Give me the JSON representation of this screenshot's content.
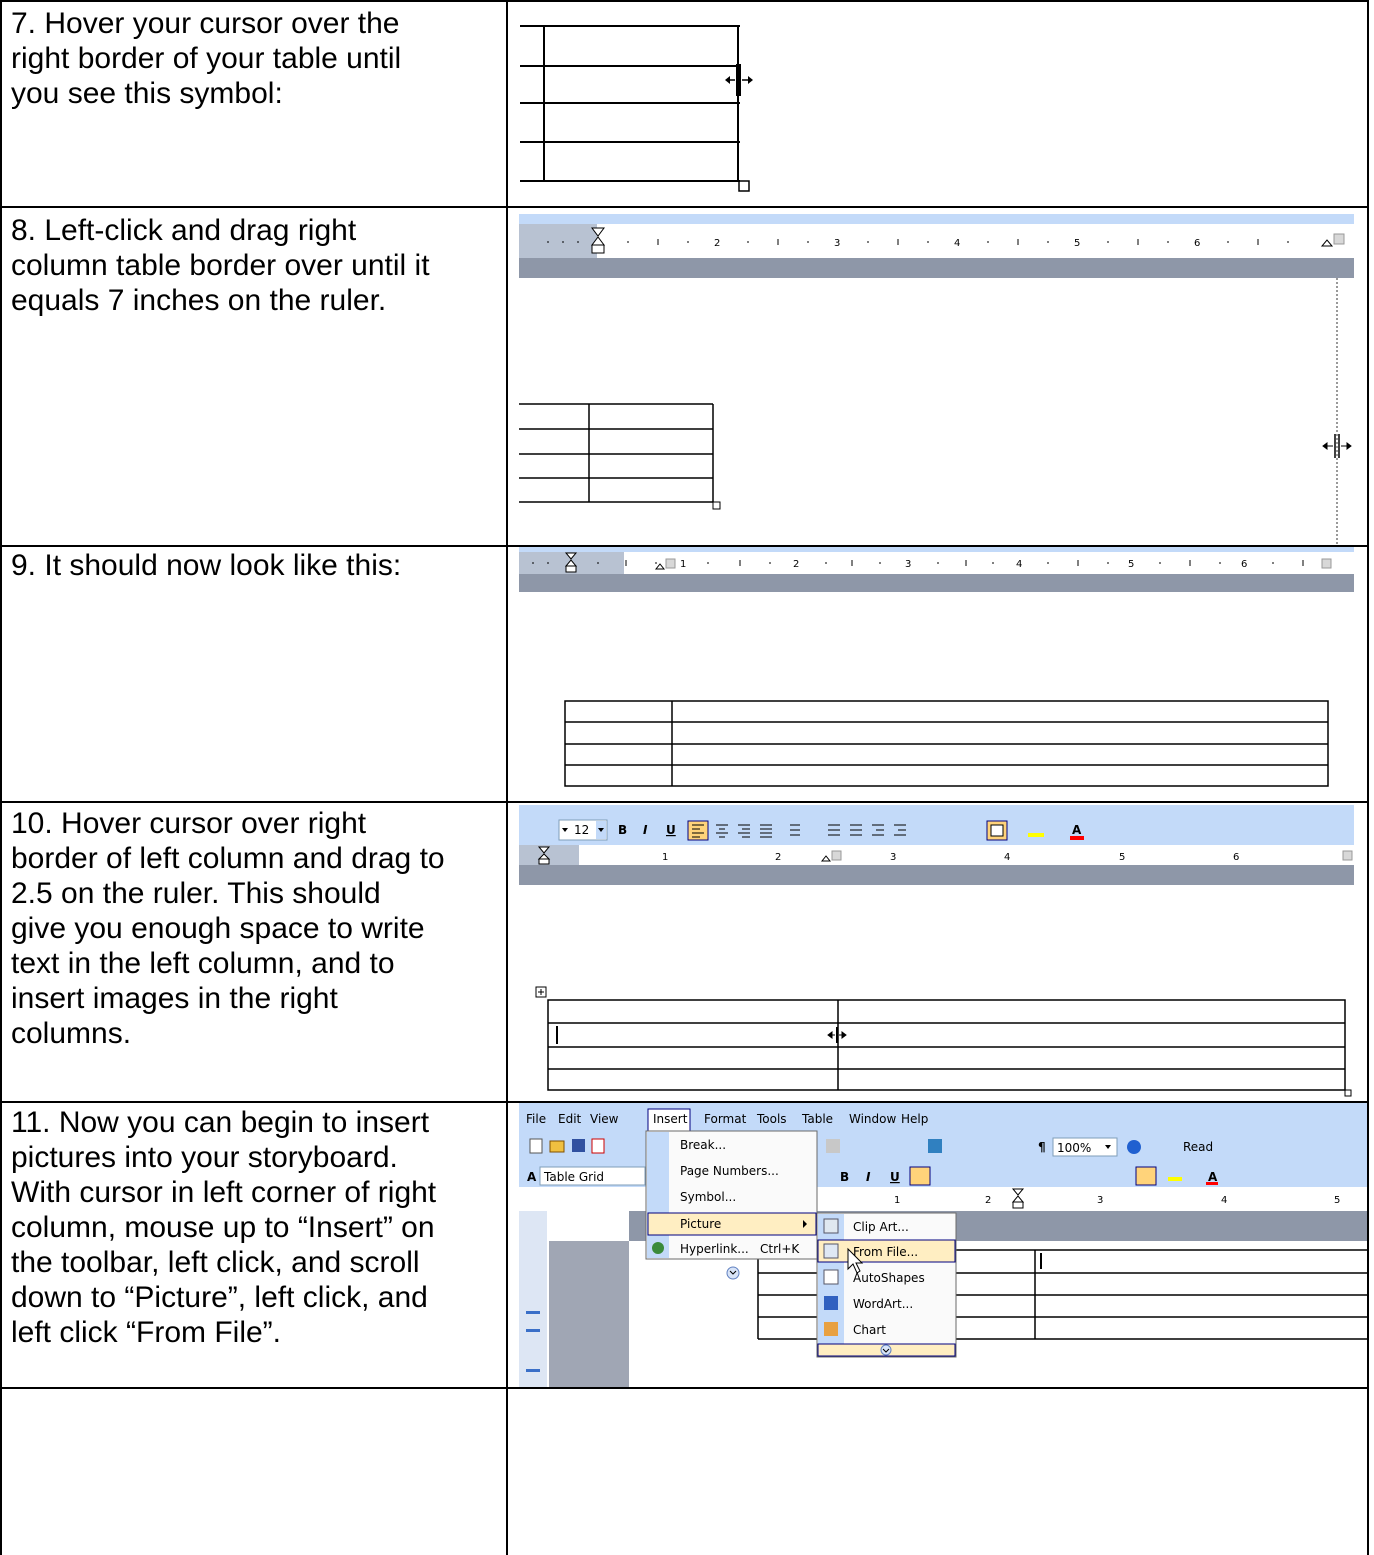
{
  "rows": [
    {
      "step": "7. Hover your cursor over the\nright border of your table until\nyou see this symbol:"
    },
    {
      "step": "8. Left-click and drag right\ncolumn table border over until it\nequals 7 inches on the ruler."
    },
    {
      "step": "9. It should now look like this:"
    },
    {
      "step": "10. Hover cursor over right\nborder of left column and drag to\n2.5 on the ruler.  This should\ngive you enough space to write\ntext in the left column, and to\ninsert images in the right\ncolumns."
    },
    {
      "step": "11. Now you can begin to insert\npictures into your storyboard.\nWith cursor in left corner of right\ncolumn, mouse up to “Insert” on\nthe toolbar, left click, and scroll\ndown to “Picture”, left click, and\nleft click “From File”."
    },
    {
      "step": ""
    }
  ],
  "ruler_numbers": [
    "1",
    "2",
    "3",
    "4",
    "5",
    "6"
  ],
  "toolbar": {
    "font_size": "12",
    "bold": "B",
    "italic": "I",
    "underline": "U",
    "zoom": "100%",
    "read": "Read",
    "style": "Table Grid",
    "style_icon": "A",
    "pilcrow": "¶"
  },
  "menubar": [
    "File",
    "Edit",
    "View",
    "Insert",
    "Format",
    "Tools",
    "Table",
    "Window",
    "Help"
  ],
  "insert_menu": [
    {
      "label": "Break...",
      "shortcut": ""
    },
    {
      "label": "Page Numbers...",
      "shortcut": ""
    },
    {
      "label": "Symbol...",
      "shortcut": ""
    },
    {
      "label": "Picture",
      "shortcut": ""
    },
    {
      "label": "Hyperlink...",
      "shortcut": "Ctrl+K"
    }
  ],
  "picture_submenu": [
    "Clip Art...",
    "From File...",
    "AutoShapes",
    "WordArt...",
    "Chart"
  ],
  "colors": {
    "menu_highlight": "#ffeec2",
    "menu_highlight_border": "#000080",
    "toolbar_blue": "#c3daf9",
    "ruler_gray": "#8e97a8",
    "page_gray": "#a0a6b4"
  },
  "icons": [
    "resize-cursor-icon",
    "table-move-handle-icon",
    "clip-art-icon",
    "from-file-icon",
    "autoshapes-icon",
    "wordart-icon",
    "chart-icon",
    "hyperlink-icon",
    "expand-chevron-icon",
    "mouse-pointer-icon"
  ]
}
